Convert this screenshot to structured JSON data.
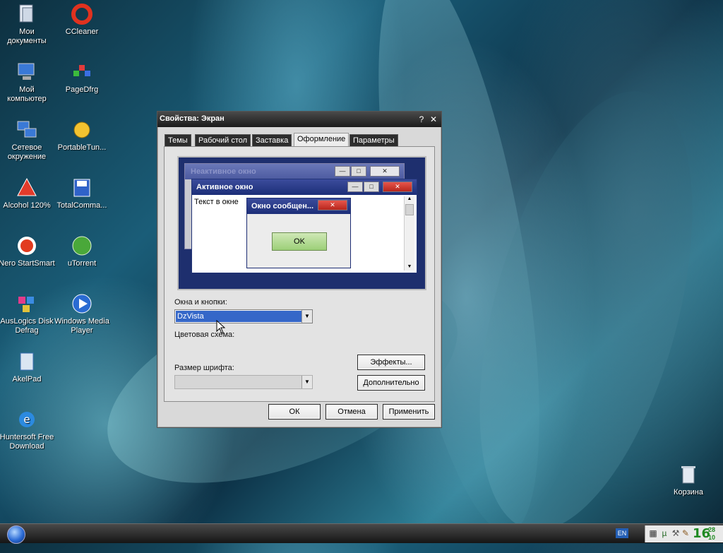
{
  "desktop": {
    "icons": [
      {
        "label": "Мои документы",
        "icon": "my-documents-icon"
      },
      {
        "label": "CCleaner",
        "icon": "ccleaner-icon"
      },
      {
        "label": "Мой компьютер",
        "icon": "my-computer-icon"
      },
      {
        "label": "PageDfrg",
        "icon": "pagedfrg-icon"
      },
      {
        "label": "Сетевое окружение",
        "icon": "network-icon"
      },
      {
        "label": "PortableTun...",
        "icon": "portabletuneup-icon"
      },
      {
        "label": "Alcohol 120%",
        "icon": "alcohol-icon"
      },
      {
        "label": "TotalComma...",
        "icon": "totalcommander-icon"
      },
      {
        "label": "Nero StartSmart",
        "icon": "nero-icon"
      },
      {
        "label": "uTorrent",
        "icon": "utorrent-icon"
      },
      {
        "label": "AusLogics Disk Defrag",
        "icon": "auslogics-icon"
      },
      {
        "label": "Windows Media Player",
        "icon": "wmp-icon"
      },
      {
        "label": "AkelPad",
        "icon": "akelpad-icon"
      },
      {
        "label": "Huntersoft Free Download",
        "icon": "ie-icon"
      },
      {
        "label": "Корзина",
        "icon": "recycle-bin-icon"
      }
    ]
  },
  "dialog": {
    "title": "Свойства: Экран",
    "help_button": "?",
    "close_button": "✕",
    "tabs": [
      "Темы",
      "Рабочий стол",
      "Заставка",
      "Оформление",
      "Параметры"
    ],
    "active_tab": "Оформление",
    "preview": {
      "inactive_window": "Неактивное окно",
      "active_window": "Активное окно",
      "window_text": "Текст в окне",
      "message_box": "Окно сообщен...",
      "ok": "OK"
    },
    "windows_buttons_label": "Окна и кнопки:",
    "windows_buttons_value": "DzVista",
    "color_scheme_label": "Цветовая схема:",
    "font_size_label": "Размер шрифта:",
    "effects_button": "Эффекты...",
    "advanced_button": "Дополнительно",
    "ok_button": "ОК",
    "cancel_button": "Отмена",
    "apply_button": "Применить"
  },
  "taskbar": {
    "language": "EN",
    "clock_hour": "16",
    "clock_minute_top": "28",
    "clock_minute_bottom": "10"
  }
}
